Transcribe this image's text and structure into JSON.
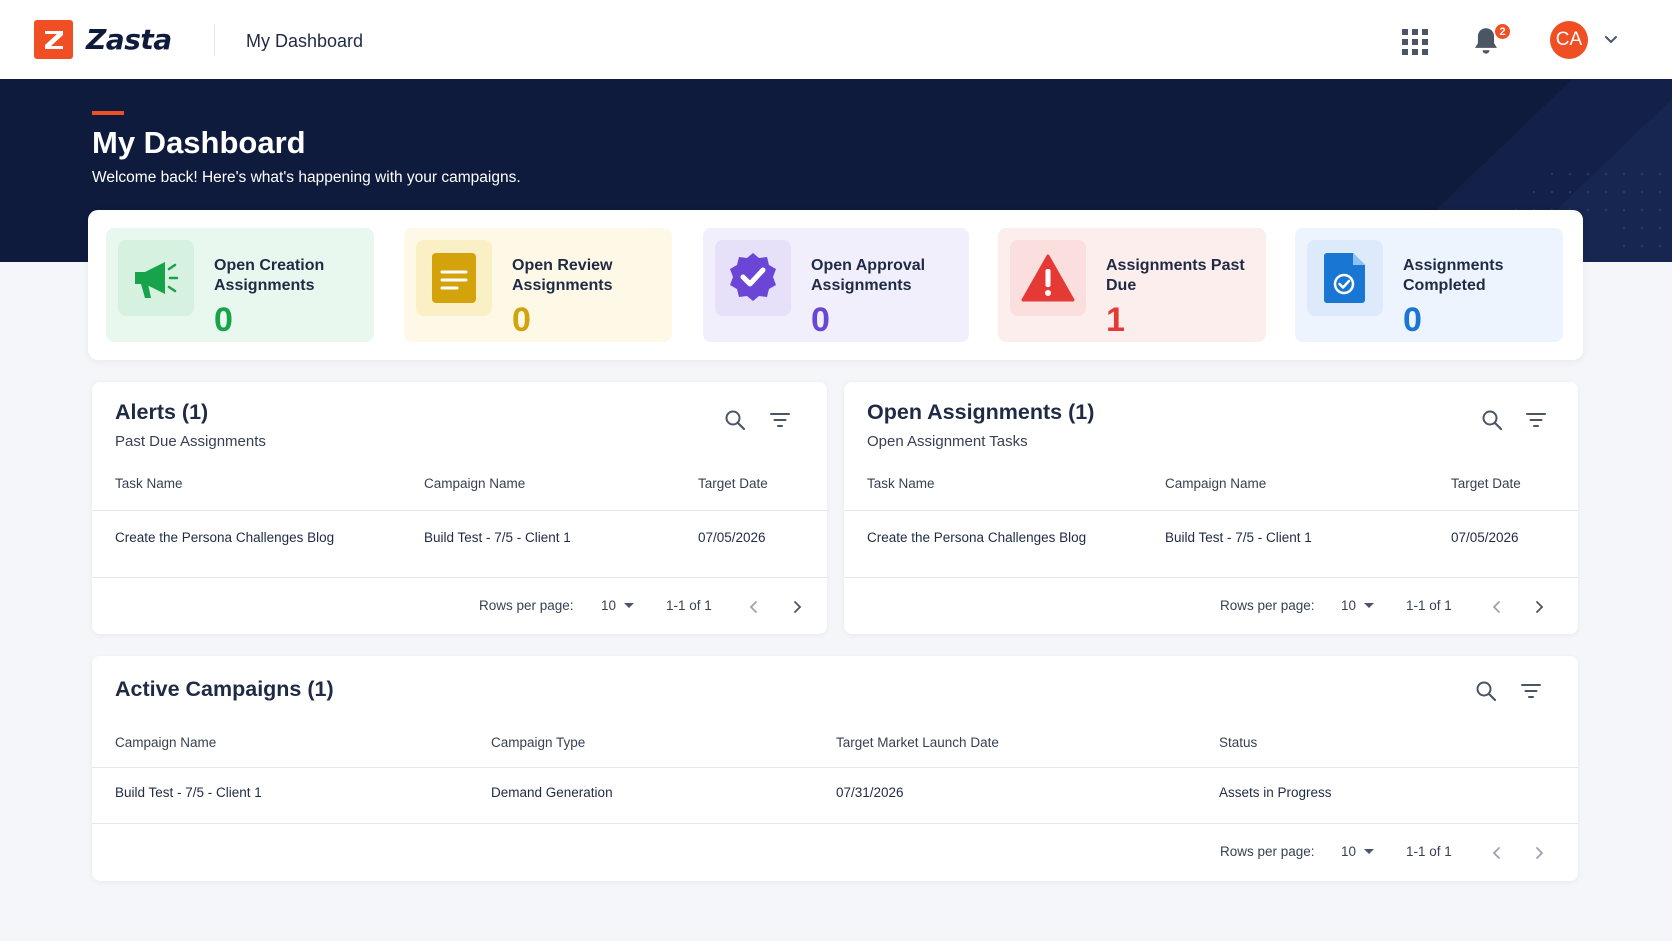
{
  "app": {
    "brand_letter": "Z",
    "brand_name": "Zasta",
    "page_title": "My Dashboard"
  },
  "header": {
    "notification_count": "2",
    "avatar_initials": "CA"
  },
  "hero": {
    "title": "My Dashboard",
    "subtitle": "Welcome back! Here's what's happening with your campaigns."
  },
  "stats": [
    {
      "label": "Open Creation Assignments",
      "value": "0",
      "icon": "megaphone-icon",
      "bg": "#e9f8ef",
      "icon_bg": "#d6f1df",
      "color": "#16a34a"
    },
    {
      "label": "Open Review Assignments",
      "value": "0",
      "icon": "document-lines-icon",
      "bg": "#fef8e6",
      "icon_bg": "#fbefc6",
      "color": "#d4a20a"
    },
    {
      "label": "Open Approval Assignments",
      "value": "0",
      "icon": "verified-badge-icon",
      "bg": "#f1effc",
      "icon_bg": "#e6e1f8",
      "color": "#6b46d6"
    },
    {
      "label": "Assignments Past Due",
      "value": "1",
      "icon": "warning-triangle-icon",
      "bg": "#fdeeee",
      "icon_bg": "#fbdede",
      "color": "#e53935"
    },
    {
      "label": "Assignments Completed",
      "value": "0",
      "icon": "completed-document-icon",
      "bg": "#edf4fd",
      "icon_bg": "#dceafb",
      "color": "#1976d2"
    }
  ],
  "alerts": {
    "title": "Alerts (1)",
    "subtitle": "Past Due Assignments",
    "columns": [
      "Task Name",
      "Campaign Name",
      "Target Date"
    ],
    "rows": [
      [
        "Create the Persona Challenges Blog",
        "Build Test - 7/5 - Client 1",
        "07/05/2026"
      ]
    ],
    "rows_per_page_label": "Rows per page:",
    "rows_per_page": "10",
    "range": "1-1 of 1"
  },
  "open_assignments": {
    "title": "Open Assignments (1)",
    "subtitle": "Open Assignment Tasks",
    "columns": [
      "Task Name",
      "Campaign Name",
      "Target Date"
    ],
    "rows": [
      [
        "Create the Persona Challenges Blog",
        "Build Test - 7/5 - Client 1",
        "07/05/2026"
      ]
    ],
    "rows_per_page_label": "Rows per page:",
    "rows_per_page": "10",
    "range": "1-1 of 1"
  },
  "active_campaigns": {
    "title": "Active Campaigns (1)",
    "columns": [
      "Campaign Name",
      "Campaign Type",
      "Target Market Launch Date",
      "Status"
    ],
    "rows": [
      [
        "Build Test - 7/5 - Client 1",
        "Demand Generation",
        "07/31/2026",
        "Assets in Progress"
      ]
    ],
    "rows_per_page_label": "Rows per page:",
    "rows_per_page": "10",
    "range": "1-1 of 1"
  }
}
